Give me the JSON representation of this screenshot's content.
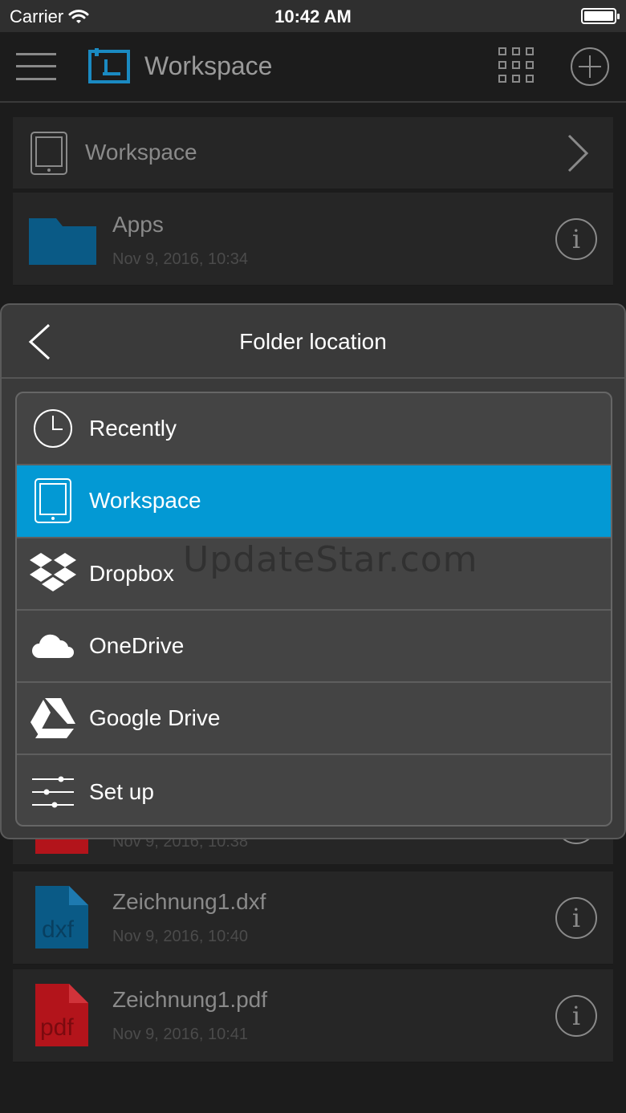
{
  "status_bar": {
    "carrier": "Carrier",
    "time": "10:42 AM"
  },
  "navbar": {
    "title": "Workspace"
  },
  "location_row": {
    "label": "Workspace"
  },
  "files": [
    {
      "name": "Apps",
      "date": "Nov 9, 2016, 10:34",
      "type": "folder"
    },
    {
      "name": "",
      "date": "Nov 9, 2016, 10:38",
      "type": "pdf"
    },
    {
      "name": "Zeichnung1.dxf",
      "date": "Nov 9, 2016, 10:40",
      "type": "dxf",
      "badge": "dxf"
    },
    {
      "name": "Zeichnung1.pdf",
      "date": "Nov 9, 2016, 10:41",
      "type": "pdf",
      "badge": "pdf"
    }
  ],
  "popup": {
    "title": "Folder location",
    "items": [
      {
        "label": "Recently",
        "icon": "clock-icon"
      },
      {
        "label": "Workspace",
        "icon": "tablet-icon",
        "selected": true
      },
      {
        "label": "Dropbox",
        "icon": "dropbox-icon"
      },
      {
        "label": "OneDrive",
        "icon": "cloud-icon"
      },
      {
        "label": "Google Drive",
        "icon": "google-drive-icon"
      },
      {
        "label": "Set up",
        "icon": "sliders-icon"
      }
    ]
  },
  "watermark": "UpdateStar.com",
  "colors": {
    "accent": "#0399d4",
    "folder": "#0a5a86",
    "pdf": "#b3141b"
  }
}
